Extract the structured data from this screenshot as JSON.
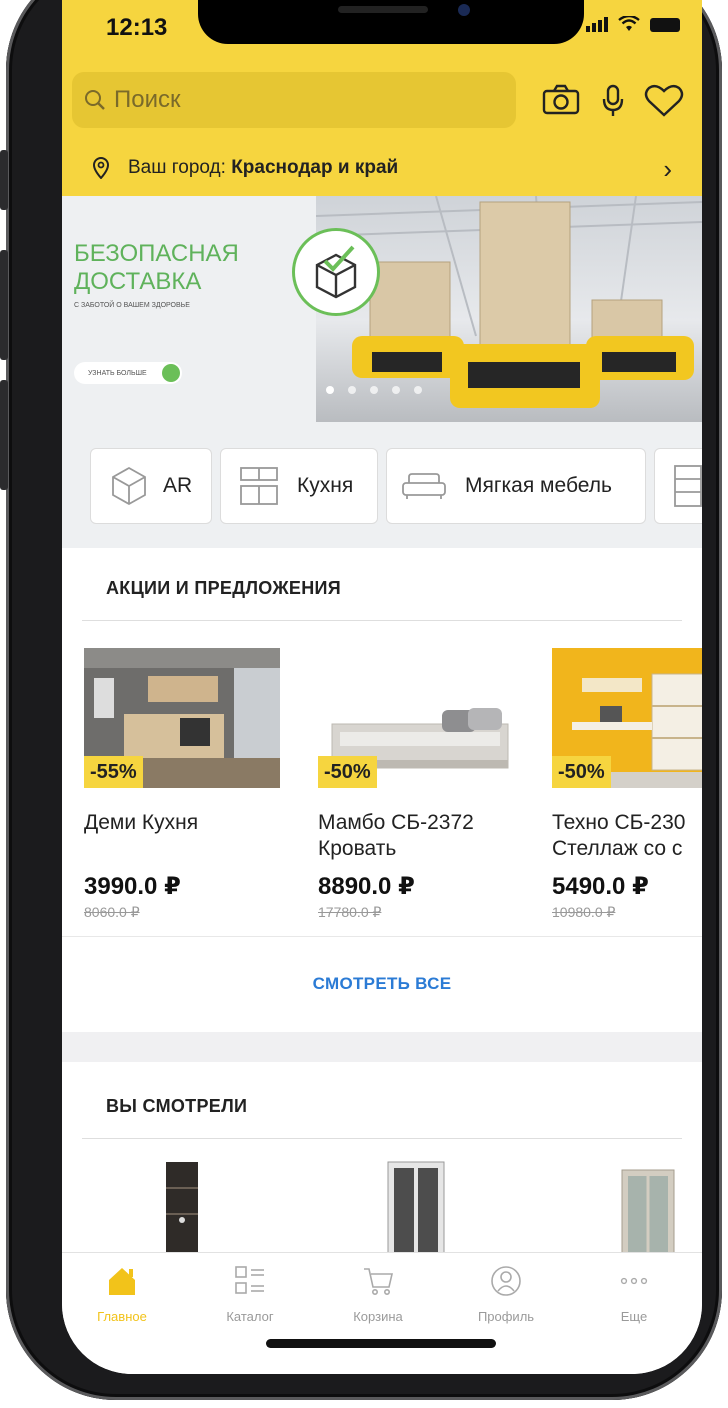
{
  "status_bar": {
    "time": "12:13"
  },
  "search": {
    "placeholder": "Поиск"
  },
  "city": {
    "prefix": "Ваш город: ",
    "value": "Краснодар и край"
  },
  "banner": {
    "title_line1": "БЕЗОПАСНАЯ",
    "title_line2": "ДОСТАВКА",
    "subtitle": "С ЗАБОТОЙ О ВАШЕМ ЗДОРОВЬЕ",
    "button_label": "УЗНАТЬ БОЛЬШЕ",
    "slides_total": 5,
    "active_slide": 1
  },
  "categories": [
    {
      "label": "AR",
      "icon": "ar-cube-icon"
    },
    {
      "label": "Кухня",
      "icon": "kitchen-icon"
    },
    {
      "label": "Мягкая мебель",
      "icon": "sofa-icon"
    }
  ],
  "promotions": {
    "title": "АКЦИИ И ПРЕДЛОЖЕНИЯ",
    "see_all": "СМОТРЕТЬ ВСЕ",
    "items": [
      {
        "discount": "-55%",
        "name_line1": "Деми Кухня",
        "name_line2": "",
        "price": "3990.0 ₽",
        "old_price": "8060.0 ₽"
      },
      {
        "discount": "-50%",
        "name_line1": "Мамбо СБ-2372",
        "name_line2": "Кровать",
        "price": "8890.0 ₽",
        "old_price": "17780.0 ₽"
      },
      {
        "discount": "-50%",
        "name_line1": "Техно СБ-230",
        "name_line2": "Стеллаж со с",
        "price": "5490.0 ₽",
        "old_price": "10980.0 ₽"
      }
    ]
  },
  "viewed": {
    "title": "ВЫ СМОТРЕЛИ"
  },
  "tabbar": [
    {
      "label": "Главное",
      "icon": "home-icon",
      "active": true
    },
    {
      "label": "Каталог",
      "icon": "catalog-icon",
      "active": false
    },
    {
      "label": "Корзина",
      "icon": "cart-icon",
      "active": false
    },
    {
      "label": "Профиль",
      "icon": "profile-icon",
      "active": false
    },
    {
      "label": "Еще",
      "icon": "more-icon",
      "active": false
    }
  ],
  "colors": {
    "accent_yellow": "#f6d53f",
    "link_blue": "#2b7bd5",
    "banner_green": "#5fb25b"
  }
}
